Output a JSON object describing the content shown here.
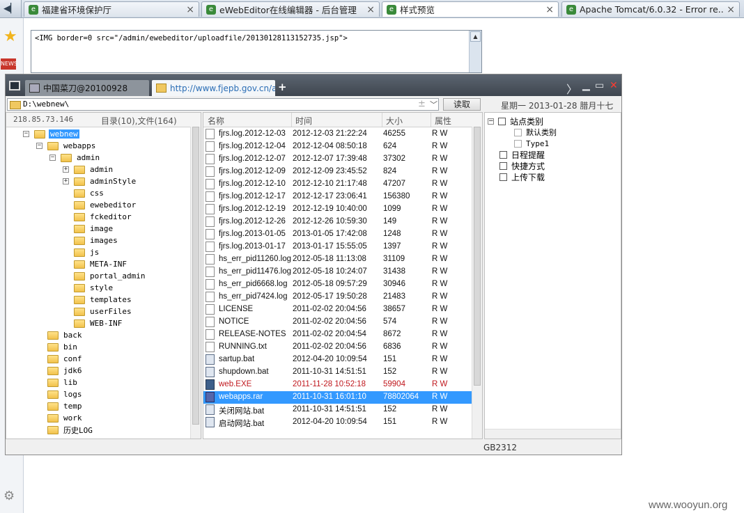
{
  "browser": {
    "tabs": [
      {
        "label": "福建省环境保护厅",
        "active": false
      },
      {
        "label": "eWebEditor在线编辑器 - 后台管理",
        "active": false
      },
      {
        "label": "样式预览",
        "active": true
      },
      {
        "label": "Apache Tomcat/6.0.32 - Error re...",
        "active": false
      }
    ],
    "close_glyph": "×",
    "favicon_glyph": "e"
  },
  "editor": {
    "code": "<IMG border=0 src=\"/admin/ewebeditor/uploadfile/20130128113152735.jsp\">"
  },
  "chopper": {
    "tabs": [
      {
        "label": "中国菜刀@20100928"
      },
      {
        "label": "http://www.fjepb.gov.cn/adm..."
      }
    ],
    "address": "D:\\webnew\\",
    "read_button": "读取",
    "date_text": "星期一 2013-01-28 腊月十七",
    "tree_header": {
      "ip": "218.85.73.146",
      "count": "目录(10),文件(164)"
    },
    "tree": [
      {
        "label": "webnew",
        "level": 0,
        "exp": "−",
        "selected": true
      },
      {
        "label": "webapps",
        "level": 1,
        "exp": "−"
      },
      {
        "label": "admin",
        "level": 2,
        "exp": "−"
      },
      {
        "label": "admin",
        "level": 3,
        "exp": "+"
      },
      {
        "label": "adminStyle",
        "level": 3,
        "exp": "+"
      },
      {
        "label": "css",
        "level": 3,
        "exp": ""
      },
      {
        "label": "ewebeditor",
        "level": 3,
        "exp": ""
      },
      {
        "label": "fckeditor",
        "level": 3,
        "exp": ""
      },
      {
        "label": "image",
        "level": 3,
        "exp": ""
      },
      {
        "label": "images",
        "level": 3,
        "exp": ""
      },
      {
        "label": "js",
        "level": 3,
        "exp": ""
      },
      {
        "label": "META-INF",
        "level": 3,
        "exp": ""
      },
      {
        "label": "portal_admin",
        "level": 3,
        "exp": ""
      },
      {
        "label": "style",
        "level": 3,
        "exp": ""
      },
      {
        "label": "templates",
        "level": 3,
        "exp": ""
      },
      {
        "label": "userFiles",
        "level": 3,
        "exp": ""
      },
      {
        "label": "WEB-INF",
        "level": 3,
        "exp": ""
      },
      {
        "label": "back",
        "level": 1,
        "exp": ""
      },
      {
        "label": "bin",
        "level": 1,
        "exp": ""
      },
      {
        "label": "conf",
        "level": 1,
        "exp": ""
      },
      {
        "label": "jdk6",
        "level": 1,
        "exp": ""
      },
      {
        "label": "lib",
        "level": 1,
        "exp": ""
      },
      {
        "label": "logs",
        "level": 1,
        "exp": ""
      },
      {
        "label": "temp",
        "level": 1,
        "exp": ""
      },
      {
        "label": "work",
        "level": 1,
        "exp": ""
      },
      {
        "label": "历史LOG",
        "level": 1,
        "exp": ""
      }
    ],
    "file_columns": {
      "name": "名称",
      "time": "时间",
      "size": "大小",
      "attr": "属性"
    },
    "files": [
      {
        "name": "fjrs.log.2012-12-03",
        "time": "2012-12-03 21:22:24",
        "size": "46255",
        "attr": "R W",
        "icon": "file"
      },
      {
        "name": "fjrs.log.2012-12-04",
        "time": "2012-12-04 08:50:18",
        "size": "624",
        "attr": "R W",
        "icon": "file"
      },
      {
        "name": "fjrs.log.2012-12-07",
        "time": "2012-12-07 17:39:48",
        "size": "37302",
        "attr": "R W",
        "icon": "file"
      },
      {
        "name": "fjrs.log.2012-12-09",
        "time": "2012-12-09 23:45:52",
        "size": "824",
        "attr": "R W",
        "icon": "file"
      },
      {
        "name": "fjrs.log.2012-12-10",
        "time": "2012-12-10 21:17:48",
        "size": "47207",
        "attr": "R W",
        "icon": "file"
      },
      {
        "name": "fjrs.log.2012-12-17",
        "time": "2012-12-17 23:06:41",
        "size": "156380",
        "attr": "R W",
        "icon": "file"
      },
      {
        "name": "fjrs.log.2012-12-19",
        "time": "2012-12-19 10:40:00",
        "size": "1099",
        "attr": "R W",
        "icon": "file"
      },
      {
        "name": "fjrs.log.2012-12-26",
        "time": "2012-12-26 10:59:30",
        "size": "149",
        "attr": "R W",
        "icon": "file"
      },
      {
        "name": "fjrs.log.2013-01-05",
        "time": "2013-01-05 17:42:08",
        "size": "1248",
        "attr": "R W",
        "icon": "file"
      },
      {
        "name": "fjrs.log.2013-01-17",
        "time": "2013-01-17 15:55:05",
        "size": "1397",
        "attr": "R W",
        "icon": "file"
      },
      {
        "name": "hs_err_pid11260.log",
        "time": "2012-05-18 11:13:08",
        "size": "31109",
        "attr": "R W",
        "icon": "file"
      },
      {
        "name": "hs_err_pid11476.log",
        "time": "2012-05-18 10:24:07",
        "size": "31438",
        "attr": "R W",
        "icon": "file"
      },
      {
        "name": "hs_err_pid6668.log",
        "time": "2012-05-18 09:57:29",
        "size": "30946",
        "attr": "R W",
        "icon": "file"
      },
      {
        "name": "hs_err_pid7424.log",
        "time": "2012-05-17 19:50:28",
        "size": "21483",
        "attr": "R W",
        "icon": "file"
      },
      {
        "name": "LICENSE",
        "time": "2011-02-02 20:04:56",
        "size": "38657",
        "attr": "R W",
        "icon": "file"
      },
      {
        "name": "NOTICE",
        "time": "2011-02-02 20:04:56",
        "size": "574",
        "attr": "R W",
        "icon": "file"
      },
      {
        "name": "RELEASE-NOTES",
        "time": "2011-02-02 20:04:54",
        "size": "8672",
        "attr": "R W",
        "icon": "file"
      },
      {
        "name": "RUNNING.txt",
        "time": "2011-02-02 20:04:56",
        "size": "6836",
        "attr": "R W",
        "icon": "file"
      },
      {
        "name": "sartup.bat",
        "time": "2012-04-20 10:09:54",
        "size": "151",
        "attr": "R W",
        "icon": "bat"
      },
      {
        "name": "shupdown.bat",
        "time": "2011-10-31 14:51:51",
        "size": "152",
        "attr": "R W",
        "icon": "bat"
      },
      {
        "name": "web.EXE",
        "time": "2011-11-28 10:52:18",
        "size": "59904",
        "attr": "R W",
        "icon": "exe",
        "red": true
      },
      {
        "name": "webapps.rar",
        "time": "2011-10-31 16:01:10",
        "size": "78802064",
        "attr": "R W",
        "icon": "rar",
        "selected": true
      },
      {
        "name": "关闭网站.bat",
        "time": "2011-10-31 14:51:51",
        "size": "152",
        "attr": "R W",
        "icon": "bat"
      },
      {
        "name": "启动网站.bat",
        "time": "2012-04-20 10:09:54",
        "size": "151",
        "attr": "R W",
        "icon": "bat"
      }
    ],
    "right_tree": [
      {
        "label": "站点类别",
        "kind": "root"
      },
      {
        "label": "默认类别",
        "kind": "leaf"
      },
      {
        "label": "Type1",
        "kind": "leaf"
      },
      {
        "label": "日程提醒",
        "kind": "item"
      },
      {
        "label": "快捷方式",
        "kind": "item"
      },
      {
        "label": "上传下载",
        "kind": "item"
      }
    ],
    "status_encoding": "GB2312"
  },
  "watermark": "www.wooyun.org",
  "colors": {
    "selection": "#3399ff",
    "red_file": "#c0181e",
    "tree_folder": "#f2c24c"
  }
}
